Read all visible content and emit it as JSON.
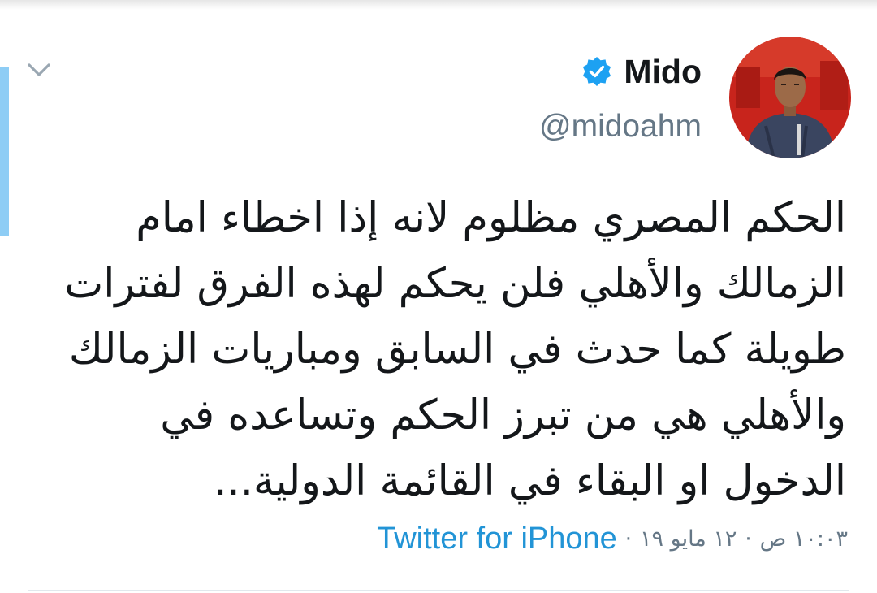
{
  "tweet": {
    "author": {
      "display_name": "Mido",
      "handle": "@midoahm",
      "verified": true
    },
    "text_lines": [
      "الحكم المصري مظلوم لانه إذا اخطاء امام",
      "الزمالك والأهلي فلن يحكم لهذه الفرق لفترات",
      "طويلة كما حدث في السابق ومباريات الزمالك",
      "والأهلي هي من تبرز الحكم وتساعده في",
      "الدخول او البقاء في القائمة الدولية..."
    ],
    "time": "١٠:٠٣ ص",
    "separator": "·",
    "date": "١٢ مايو ١٩",
    "source": "Twitter for iPhone"
  },
  "icons": {
    "menu": "chevron-down-icon",
    "verified": "verified-badge-icon"
  },
  "colors": {
    "verified_blue": "#1da1f2",
    "link_blue": "#2294d6",
    "muted": "#657786",
    "text": "#14171a",
    "thread_accent": "#8ecdf5"
  }
}
